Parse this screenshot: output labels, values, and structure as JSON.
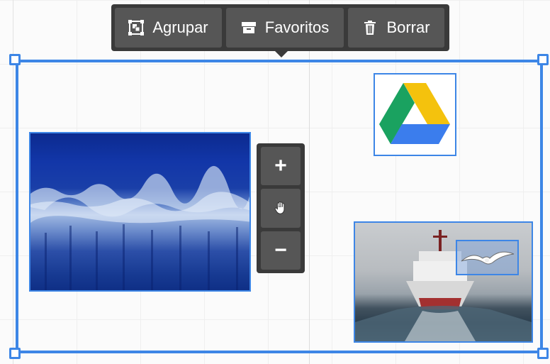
{
  "toolbar": {
    "group_label": "Agrupar",
    "group_icon": "group-icon",
    "favorites_label": "Favoritos",
    "favorites_icon": "archive-box-icon",
    "delete_label": "Borrar",
    "delete_icon": "trash-icon"
  },
  "zoom": {
    "zoom_in_label": "+",
    "pan_icon": "hand-icon",
    "zoom_out_label": "−"
  },
  "colors": {
    "selection": "#3d86e6",
    "toolbar_bg": "#3a3a3a",
    "button_bg": "#565656"
  },
  "images": {
    "forest": "frozen-forest-image",
    "gdrive": "google-drive-logo",
    "ship": "ship-image",
    "gull": "seagull-image"
  }
}
